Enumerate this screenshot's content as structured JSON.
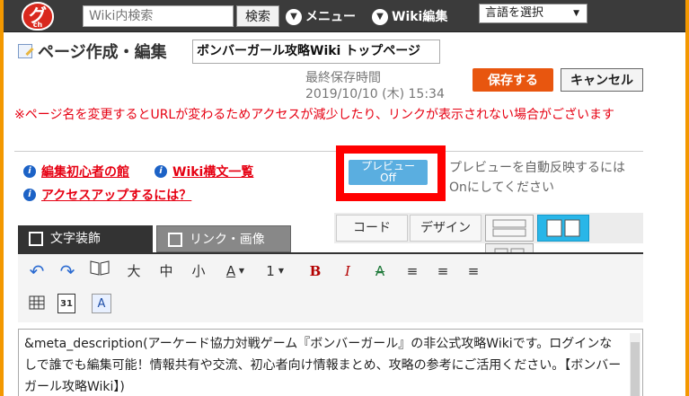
{
  "topbar": {
    "logo_text": "グ",
    "logo_sub": "ch",
    "search_placeholder": "Wiki内検索",
    "search_button": "検索",
    "menu_label": "メニュー",
    "wiki_edit_label": "Wiki編集",
    "language_select": "言語を選択"
  },
  "header": {
    "heading": "ページ作成・編集",
    "page_title_value": "ボンバーガール攻略Wiki トップページ",
    "last_saved_label": "最終保存時間",
    "last_saved_time": "2019/10/10 (木) 15:34",
    "save_button": "保存する",
    "cancel_button": "キャンセル"
  },
  "warning": "※ページ名を変更するとURLが変わるためアクセスが減少したり、リンクが表示されない場合がございます",
  "help_links": [
    "編集初心者の館",
    "Wiki構文一覧",
    "アクセスアップするには？"
  ],
  "preview": {
    "toggle_line1": "プレビュー",
    "toggle_line2": "Off",
    "note_line1": "プレビューを自動反映するには",
    "note_line2": "Onにしてください"
  },
  "modes": {
    "code": "コード",
    "design": "デザイン"
  },
  "tabs": [
    "文字装飾",
    "リンク・画像"
  ],
  "toolbar": {
    "large": "大",
    "medium": "中",
    "small": "小",
    "font_color": "A",
    "font_size": "1",
    "bold": "B",
    "italic": "I",
    "strike": "A",
    "calendar": "31",
    "text_box": "A"
  },
  "editor_text": "&meta_description(アーケード協力対戦ゲーム『ボンバーガール』の非公式攻略Wikiです。ログインなしで誰でも編集可能！情報共有や交流、初心者向け情報まとめ、攻略の参考にご活用ください。【ボンバーガール攻略Wiki】)",
  "colors": {
    "accent_orange": "#f39800",
    "save_orange": "#e8560f",
    "warning_red": "#e60012",
    "highlight_red": "#ff0000",
    "preview_blue": "#5aaee0"
  }
}
